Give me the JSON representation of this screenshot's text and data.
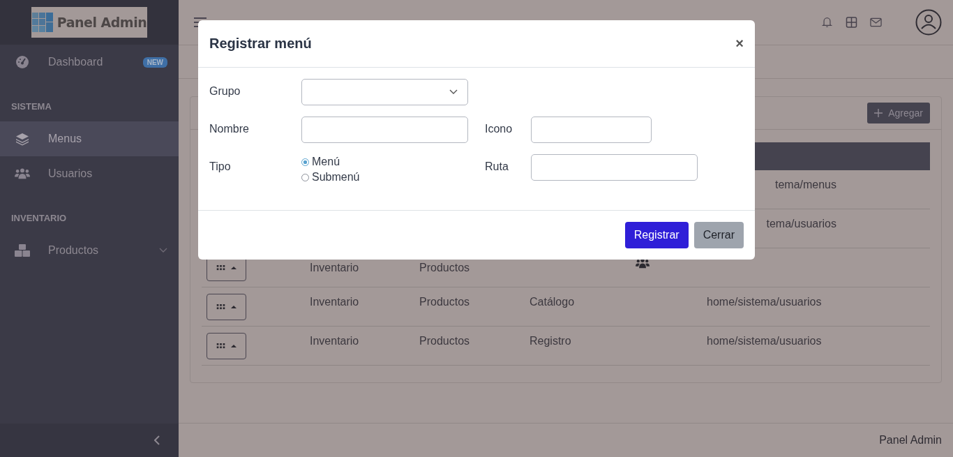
{
  "sidebar": {
    "logo": "Panel Admin",
    "items": [
      {
        "kind": "item",
        "label": "Dashboard",
        "badge": "NEW",
        "selected": false
      },
      {
        "kind": "section",
        "label": "SISTEMA"
      },
      {
        "kind": "item",
        "label": "Menus",
        "selected": true
      },
      {
        "kind": "item",
        "label": "Usuarios",
        "selected": false
      },
      {
        "kind": "section",
        "label": "INVENTARIO"
      },
      {
        "kind": "item",
        "label": "Productos",
        "selected": false,
        "expandable": true
      }
    ]
  },
  "card": {
    "add_button": "Agregar"
  },
  "table": {
    "rows": [
      {
        "ruta": "tema/menus"
      },
      {
        "ruta": "tema/usuarios"
      },
      {
        "grupo": "Inventario",
        "menu": "Productos",
        "has_icon": true
      },
      {
        "grupo": "Inventario",
        "menu": "Productos",
        "submenu": "Catálogo",
        "ruta": "home/sistema/usuarios"
      },
      {
        "grupo": "Inventario",
        "menu": "Productos",
        "submenu": "Registro",
        "ruta": "home/sistema/usuarios"
      }
    ]
  },
  "footer": "Panel Admin",
  "modal": {
    "title": "Registrar menú",
    "close": "×",
    "grupo": {
      "label": "Grupo"
    },
    "nombre": {
      "label": "Nombre"
    },
    "icono": {
      "label": "Icono"
    },
    "tipo": {
      "label": "Tipo",
      "options": [
        {
          "label": "Menú",
          "selected": true
        },
        {
          "label": "Submenú",
          "selected": false
        }
      ]
    },
    "ruta": {
      "label": "Ruta"
    },
    "buttons": [
      {
        "label": "Registrar",
        "kind": "primary"
      },
      {
        "label": "Cerrar",
        "kind": "secondary"
      }
    ]
  }
}
